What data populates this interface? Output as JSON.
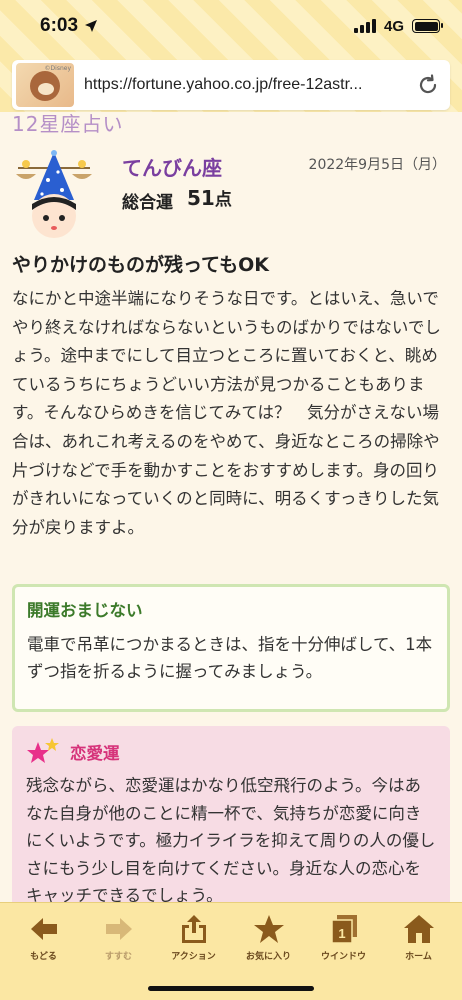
{
  "status_bar": {
    "time": "6:03",
    "network": "4G"
  },
  "browser": {
    "url": "https://fortune.yahoo.co.jp/free-12astr...",
    "thumbnail_label": "©Disney"
  },
  "page": {
    "cut_heading": "12星座占い",
    "sign_name": "てんびん座",
    "date": "2022年9月5日（月）",
    "score_label": "総合運",
    "score_value": "51",
    "score_unit": "点",
    "headline": "やりかけのものが残ってもOK",
    "body": "なにかと中途半端になりそうな日です。とはいえ、急いでやり終えなければならないというものばかりではないでしょう。途中までにして目立つところに置いておくと、眺めているうちにちょうどいい方法が見つかることもあります。そんなひらめきを信じてみては？　気分がさえない場合は、あれこれ考えるのをやめて、身近なところの掃除や片づけなどで手を動かすことをおすすめします。身の回りがきれいになっていくのと同時に、明るくすっきりした気分が戻りますよ。",
    "charm": {
      "title": "開運おまじない",
      "text": "電車で吊革につかまるときは、指を十分伸ばして、1本ずつ指を折るように握ってみましょう。"
    },
    "love": {
      "title": "恋愛運",
      "text": "残念ながら、恋愛運はかなり低空飛行のよう。今はあなた自身が他のことに精一杯で、気持ちが恋愛に向きにくいようです。極力イライラを抑えて周りの人の優しさにもう少し目を向けてください。身近な人の恋心をキャッチできるでしょう。"
    }
  },
  "toolbar": {
    "back": "もどる",
    "forward": "すすむ",
    "action": "アクション",
    "favorite": "お気に入り",
    "window": "ウインドウ",
    "window_count": "1",
    "home": "ホーム"
  },
  "colors": {
    "accent_purple": "#7a3fa0",
    "charm_green": "#3c7a2a",
    "love_pink": "#d6337a",
    "toolbar_bg": "#fbe7a3"
  }
}
